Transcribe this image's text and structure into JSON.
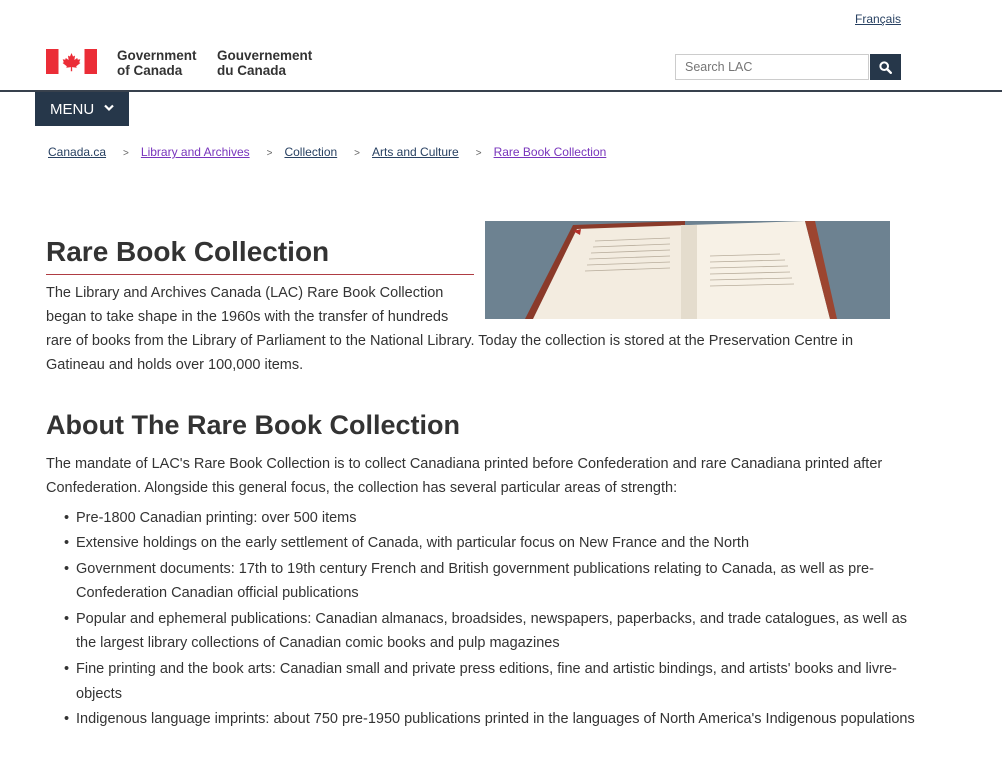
{
  "header": {
    "language_link": "Français",
    "signature_en": [
      "Government",
      "of Canada"
    ],
    "signature_fr": [
      "Gouvernement",
      "du Canada"
    ],
    "search": {
      "placeholder": "Search LAC",
      "button_icon": "search-icon"
    },
    "menu_label": "MENU"
  },
  "breadcrumb": [
    "Canada.ca",
    "Library and Archives",
    "Collection",
    "Arts and Culture",
    "Rare Book Collection"
  ],
  "main": {
    "title": "Rare Book Collection",
    "intro": "The Library and Archives Canada (LAC) Rare Book Collection began to take shape in the 1960s with the transfer of hundreds rare of books from the Library of Parliament to the National Library. Today the collection is stored at the Preservation Centre in Gatineau and holds over 100,000 items.",
    "about_heading": "About The Rare Book Collection",
    "mandate": "The mandate of LAC's Rare Book Collection is to collect Canadiana printed before Confederation and rare Canadiana printed after Confederation. Alongside this general focus, the collection has several particular areas of strength:",
    "strengths": [
      "Pre-1800 Canadian printing: over 500 items",
      "Extensive holdings on the early settlement of Canada, with particular focus on New France and the North",
      "Government documents: 17th to 19th century French and British government publications relating to Canada, as well as pre-Confederation Canadian official publications",
      "Popular and ephemeral publications: Canadian almanacs, broadsides, newspapers, paperbacks, and trade catalogues, as well as the largest library collections of Canadian comic books and pulp magazines",
      "Fine printing and the book arts: Canadian small and private press editions, fine and artistic bindings, and artists' books and livre-objects",
      "Indigenous language imprints: about 750 pre-1950 publications printed in the languages of North America's Indigenous populations"
    ]
  },
  "colors": {
    "brand_red": "#eb2d37",
    "nav_dark": "#26374a",
    "link": "#284162",
    "visited": "#7834bc",
    "title_rule": "#af3c43"
  }
}
